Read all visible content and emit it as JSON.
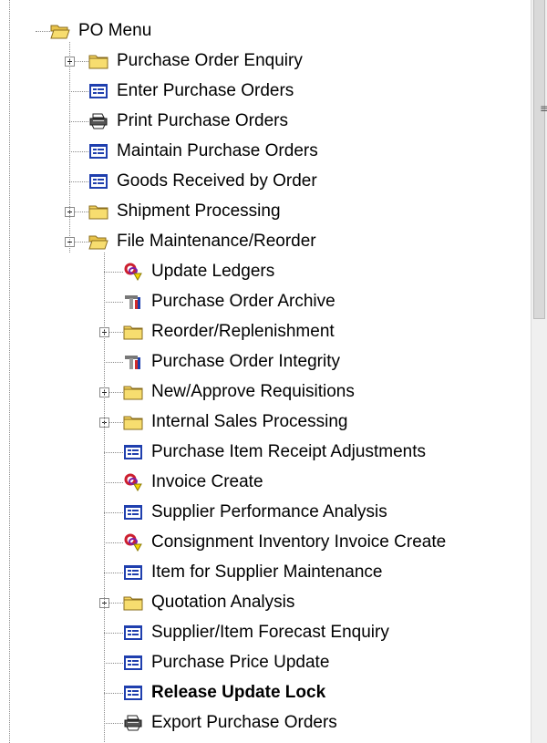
{
  "tree": {
    "root": {
      "label": "PO Menu",
      "icon": "folder-open-icon",
      "expanded": true
    },
    "items": [
      {
        "label": "Purchase Order Enquiry",
        "icon": "folder-icon",
        "expandable": true,
        "expanded": false
      },
      {
        "label": "Enter Purchase Orders",
        "icon": "form-window-icon"
      },
      {
        "label": "Print Purchase Orders",
        "icon": "printer-icon"
      },
      {
        "label": "Maintain Purchase Orders",
        "icon": "form-window-icon"
      },
      {
        "label": "Goods Received by Order",
        "icon": "form-window-icon"
      },
      {
        "label": "Shipment Processing",
        "icon": "folder-icon",
        "expandable": true,
        "expanded": false
      },
      {
        "label": "File Maintenance/Reorder",
        "icon": "folder-open-icon",
        "expandable": true,
        "expanded": true,
        "children": [
          {
            "label": "Update Ledgers",
            "icon": "process-icon"
          },
          {
            "label": "Purchase Order Archive",
            "icon": "tools-icon"
          },
          {
            "label": "Reorder/Replenishment",
            "icon": "folder-icon",
            "expandable": true,
            "expanded": false
          },
          {
            "label": "Purchase Order Integrity",
            "icon": "tools-icon"
          },
          {
            "label": "New/Approve Requisitions",
            "icon": "folder-icon",
            "expandable": true,
            "expanded": false
          },
          {
            "label": "Internal Sales Processing",
            "icon": "folder-icon",
            "expandable": true,
            "expanded": false
          },
          {
            "label": "Purchase Item Receipt Adjustments",
            "icon": "form-window-icon"
          },
          {
            "label": "Invoice Create",
            "icon": "process-icon"
          },
          {
            "label": "Supplier Performance Analysis",
            "icon": "form-window-icon"
          },
          {
            "label": "Consignment Inventory Invoice Create",
            "icon": "process-icon"
          },
          {
            "label": "Item for Supplier Maintenance",
            "icon": "form-window-icon"
          },
          {
            "label": "Quotation Analysis",
            "icon": "folder-icon",
            "expandable": true,
            "expanded": false
          },
          {
            "label": "Supplier/Item Forecast Enquiry",
            "icon": "form-window-icon"
          },
          {
            "label": "Purchase Price Update",
            "icon": "form-window-icon"
          },
          {
            "label": "Release Update Lock",
            "icon": "form-window-icon",
            "bold": true
          },
          {
            "label": "Export Purchase Orders",
            "icon": "printer-icon"
          }
        ]
      }
    ]
  },
  "scrollbar": {
    "position_fraction": 0.0,
    "visible_fraction": 0.43
  }
}
